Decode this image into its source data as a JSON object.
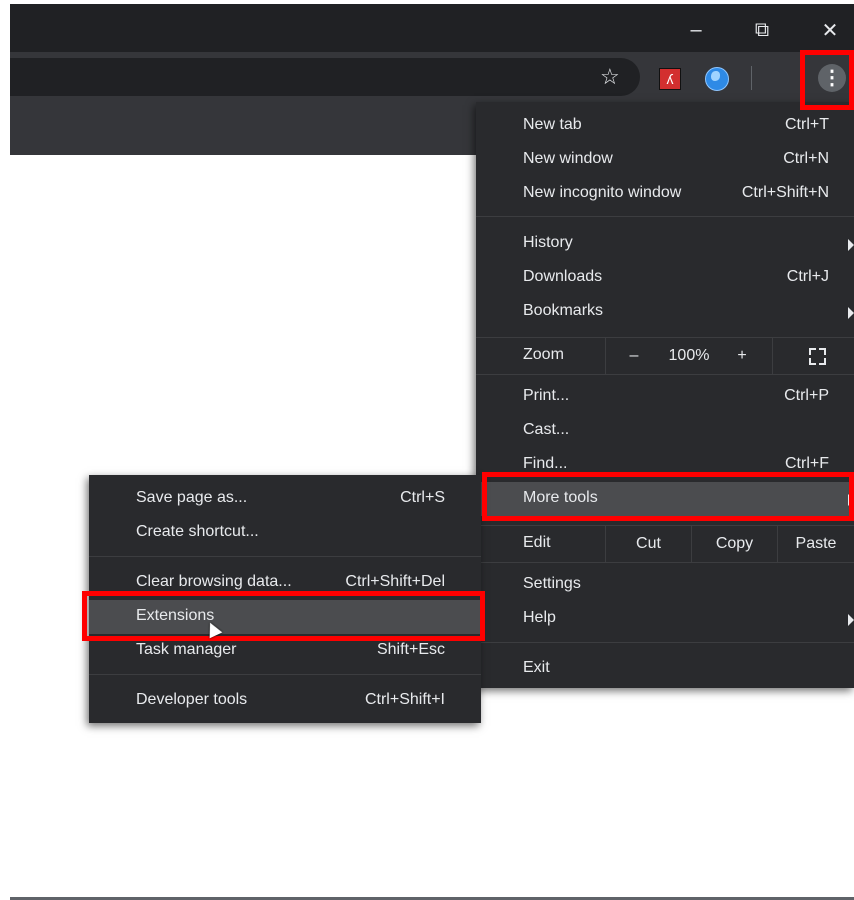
{
  "window_controls": {
    "minimize": "–",
    "restore": "⧉",
    "close": "✕"
  },
  "toolbar": {
    "bookmark_star": "☆",
    "menu_glyph": "⋮"
  },
  "main_menu": {
    "group1": [
      {
        "label": "New tab",
        "shortcut": "Ctrl+T"
      },
      {
        "label": "New window",
        "shortcut": "Ctrl+N"
      },
      {
        "label": "New incognito window",
        "shortcut": "Ctrl+Shift+N"
      }
    ],
    "group2": [
      {
        "label": "History"
      },
      {
        "label": "Downloads",
        "shortcut": "Ctrl+J"
      },
      {
        "label": "Bookmarks"
      }
    ],
    "zoom": {
      "label": "Zoom",
      "minus": "–",
      "value": "100%",
      "plus": "+"
    },
    "group3": [
      {
        "label": "Print...",
        "shortcut": "Ctrl+P"
      },
      {
        "label": "Cast..."
      },
      {
        "label": "Find...",
        "shortcut": "Ctrl+F"
      },
      {
        "label": "More tools"
      }
    ],
    "edit": {
      "label": "Edit",
      "cut": "Cut",
      "copy": "Copy",
      "paste": "Paste"
    },
    "group4": [
      {
        "label": "Settings"
      },
      {
        "label": "Help"
      }
    ],
    "exit": "Exit"
  },
  "more_tools_submenu": {
    "group1": [
      {
        "label": "Save page as...",
        "shortcut": "Ctrl+S"
      },
      {
        "label": "Create shortcut..."
      }
    ],
    "group2": [
      {
        "label": "Clear browsing data...",
        "shortcut": "Ctrl+Shift+Del"
      },
      {
        "label": "Extensions"
      },
      {
        "label": "Task manager",
        "shortcut": "Shift+Esc"
      }
    ],
    "group3": [
      {
        "label": "Developer tools",
        "shortcut": "Ctrl+Shift+I"
      }
    ]
  },
  "colors": {
    "menu_bg": "#292a2d",
    "toolbar_bg": "#35363a",
    "highlight": "#ff0000",
    "hover": "#4b4c4f"
  }
}
